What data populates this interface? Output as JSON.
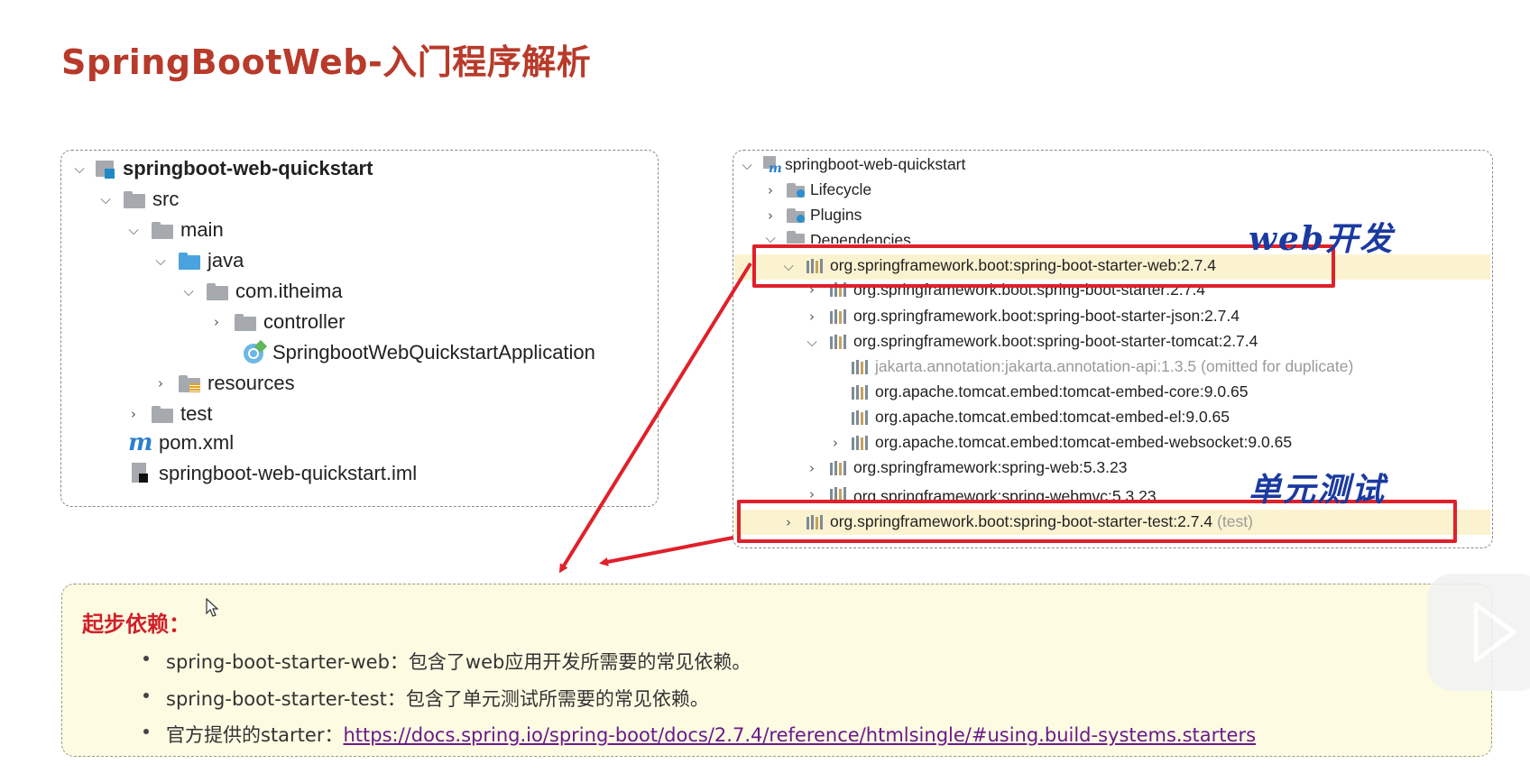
{
  "slide": {
    "title": "SpringBootWeb-入门程序解析"
  },
  "left_tree": {
    "project": "springboot-web-quickstart",
    "src": "src",
    "main": "main",
    "java": "java",
    "package": "com.itheima",
    "controller": "controller",
    "app_class": "SpringbootWebQuickstartApplication",
    "resources": "resources",
    "test": "test",
    "pom": "pom.xml",
    "iml": "springboot-web-quickstart.iml"
  },
  "right_tree": {
    "project": "springboot-web-quickstart",
    "lifecycle": "Lifecycle",
    "plugins": "Plugins",
    "dependencies": "Dependencies",
    "dep_web": "org.springframework.boot:spring-boot-starter-web:2.7.4",
    "dep_starter": "org.springframework.boot:spring-boot-starter:2.7.4",
    "dep_json": "org.springframework.boot:spring-boot-starter-json:2.7.4",
    "dep_tomcat": "org.springframework.boot:spring-boot-starter-tomcat:2.7.4",
    "dep_jakarta": "jakarta.annotation:jakarta.annotation-api:1.3.5",
    "dep_jakarta_note": "(omitted for duplicate)",
    "dep_tomcat_core": "org.apache.tomcat.embed:tomcat-embed-core:9.0.65",
    "dep_tomcat_el": "org.apache.tomcat.embed:tomcat-embed-el:9.0.65",
    "dep_tomcat_ws": "org.apache.tomcat.embed:tomcat-embed-websocket:9.0.65",
    "dep_spring_web": "org.springframework:spring-web:5.3.23",
    "dep_webmvc": "org.springframework:spring-webmvc:5.3.23",
    "dep_test": "org.springframework.boot:spring-boot-starter-test:2.7.4",
    "dep_test_scope": "(test)"
  },
  "annotations": {
    "web_dev": "web开发",
    "unit_test": "单元测试"
  },
  "info_box": {
    "title": "起步依赖：",
    "bullet1": "spring-boot-starter-web：包含了web应用开发所需要的常见依赖。",
    "bullet2": "spring-boot-starter-test：包含了单元测试所需要的常见依赖。",
    "bullet3_prefix": "官方提供的starter：",
    "bullet3_link": "https://docs.spring.io/spring-boot/docs/2.7.4/reference/htmlsingle/#using.build-systems.starters"
  },
  "colors": {
    "title": "#b83a2a",
    "highlight": "#e0202a",
    "note": "#1a3aa0"
  }
}
